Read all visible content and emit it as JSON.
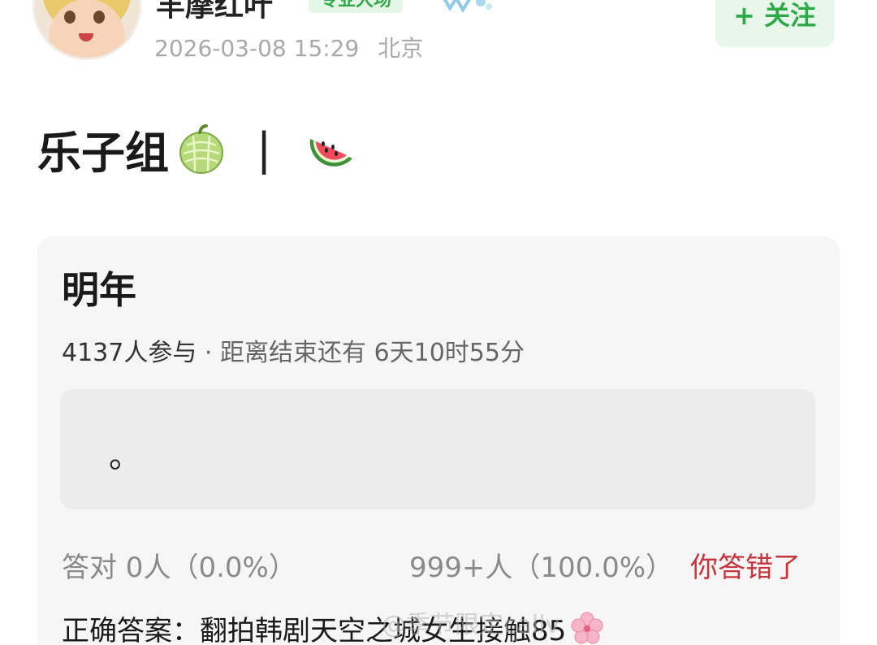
{
  "header": {
    "username": "羊摩红叶",
    "user_tag": "专业大场",
    "timestamp": "2026-03-08 15:29",
    "location": "北京",
    "follow_label": "+ 关注"
  },
  "post": {
    "title": "乐子组",
    "separator": "|",
    "title_icons": [
      "melon-icon",
      "watermelon-icon"
    ]
  },
  "quiz": {
    "title": "明年",
    "participants": "4137人参与",
    "dot": "·",
    "remaining": "距离结束还有 6天10时55分",
    "question": "。",
    "correct_label": "答对  0人（0.0%）",
    "wrong_label": "999+人（100.0%）",
    "result_label": "你答错了",
    "answer_label": "正确答案：翻拍韩剧天空之城女生接触85",
    "answer_icon": "cherry-blossom-icon"
  },
  "watermark": {
    "text": "@季节限定callv"
  },
  "colors": {
    "accent_green": "#2fa849",
    "follow_bg": "#e7f7ea",
    "wrong_red": "#c6343d",
    "card_bg": "#f6f6f6"
  }
}
